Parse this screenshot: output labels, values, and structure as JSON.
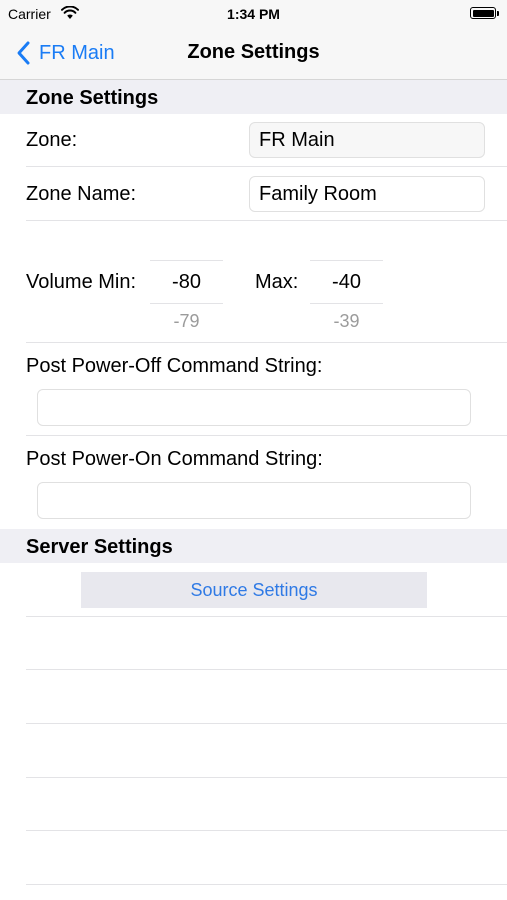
{
  "status_bar": {
    "carrier": "Carrier",
    "time": "1:34 PM"
  },
  "nav": {
    "back_label": "FR Main",
    "title": "Zone Settings",
    "accent": "#1a7cf5"
  },
  "zone_section": {
    "header": "Zone Settings",
    "zone_label": "Zone:",
    "zone_value": "FR Main",
    "zone_name_label": "Zone Name:",
    "zone_name_value": "Family Room",
    "volume_min_label": "Volume Min:",
    "volume_min_value": "-80",
    "volume_min_hint": "-79",
    "volume_max_label": "Max:",
    "volume_max_value": "-40",
    "volume_max_hint": "-39",
    "post_power_off_label": "Post Power-Off Command String:",
    "post_power_off_value": "",
    "post_power_on_label": "Post Power-On Command String:",
    "post_power_on_value": ""
  },
  "server_section": {
    "header": "Server Settings",
    "source_settings_button": "Source Settings"
  },
  "icons": {
    "wifi": "wifi-icon",
    "battery": "battery-icon",
    "back": "chevron-left-icon"
  }
}
